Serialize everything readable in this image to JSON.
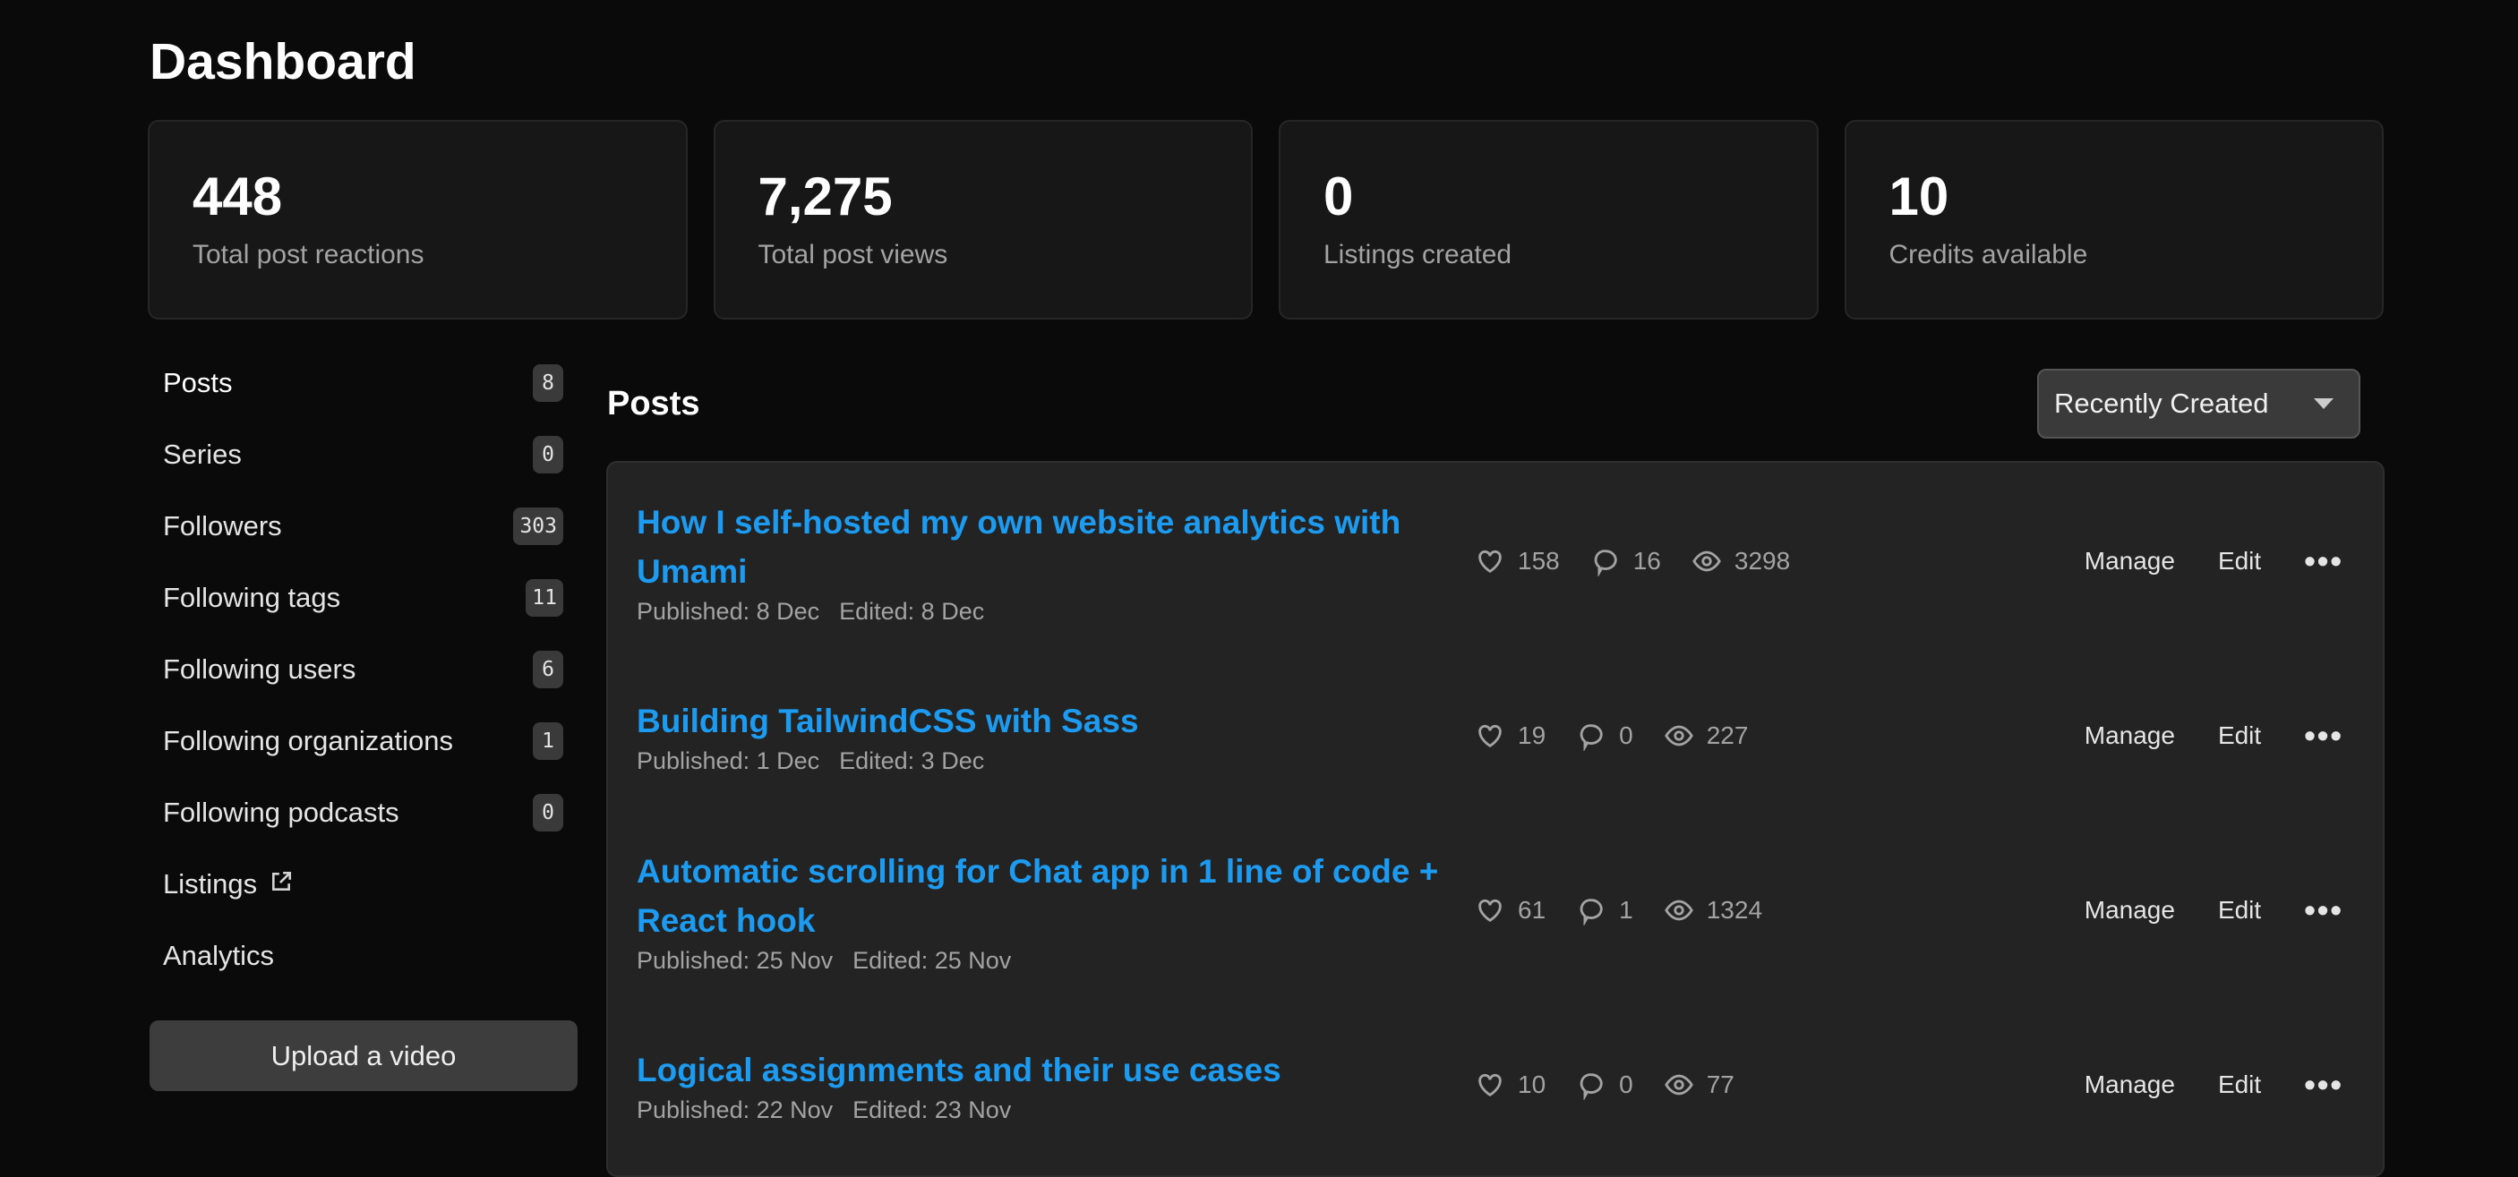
{
  "header": {
    "title": "Dashboard"
  },
  "stats": [
    {
      "value": "448",
      "label": "Total post reactions"
    },
    {
      "value": "7,275",
      "label": "Total post views"
    },
    {
      "value": "0",
      "label": "Listings created"
    },
    {
      "value": "10",
      "label": "Credits available"
    }
  ],
  "sidebar": {
    "items": [
      {
        "label": "Posts",
        "count": "8"
      },
      {
        "label": "Series",
        "count": "0"
      },
      {
        "label": "Followers",
        "count": "303"
      },
      {
        "label": "Following tags",
        "count": "11"
      },
      {
        "label": "Following users",
        "count": "6"
      },
      {
        "label": "Following organizations",
        "count": "1"
      },
      {
        "label": "Following podcasts",
        "count": "0"
      },
      {
        "label": "Listings",
        "icon": "external-link-icon"
      },
      {
        "label": "Analytics"
      }
    ],
    "upload_label": "Upload a video"
  },
  "main": {
    "heading": "Posts",
    "sort": "Recently Created",
    "accent": "#1d9bf0",
    "actions": {
      "manage": "Manage",
      "edit": "Edit"
    },
    "posts": [
      {
        "title": "How I self-hosted my own website analytics with Umami",
        "published": "Published: 8 Dec",
        "edited": "Edited: 8 Dec",
        "reactions": "158",
        "comments": "16",
        "views": "3298"
      },
      {
        "title": "Building TailwindCSS with Sass",
        "published": "Published: 1 Dec",
        "edited": "Edited: 3 Dec",
        "reactions": "19",
        "comments": "0",
        "views": "227"
      },
      {
        "title": "Automatic scrolling for Chat app in 1 line of code + React hook",
        "published": "Published: 25 Nov",
        "edited": "Edited: 25 Nov",
        "reactions": "61",
        "comments": "1",
        "views": "1324"
      },
      {
        "title": "Logical assignments and their use cases",
        "published": "Published: 22 Nov",
        "edited": "Edited: 23 Nov",
        "reactions": "10",
        "comments": "0",
        "views": "77"
      }
    ]
  }
}
